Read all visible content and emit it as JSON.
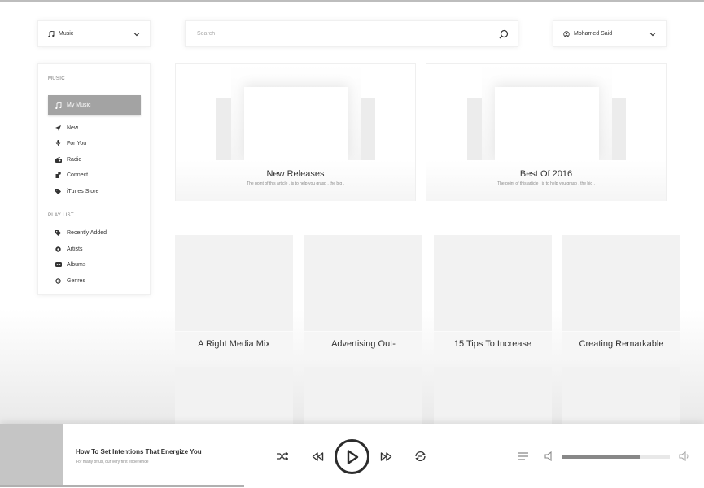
{
  "header": {
    "category_label": "Music",
    "search_placeholder": "Search",
    "user_name": "Mohamed Said"
  },
  "sidebar": {
    "music_title": "MUSIC",
    "active_item": "My Music",
    "music_items": [
      {
        "label": "New",
        "icon": "send-icon"
      },
      {
        "label": "For You",
        "icon": "microphone-icon"
      },
      {
        "label": "Radio",
        "icon": "radio-icon"
      },
      {
        "label": "Connect",
        "icon": "connect-icon"
      },
      {
        "label": "iTunes Store",
        "icon": "tag-icon"
      }
    ],
    "playlist_title": "PLAY LIST",
    "playlist_items": [
      {
        "label": "Recently Added",
        "icon": "tag-icon"
      },
      {
        "label": "Artists",
        "icon": "artist-icon"
      },
      {
        "label": "Albums",
        "icon": "album-icon"
      },
      {
        "label": "Genres",
        "icon": "genre-icon"
      }
    ]
  },
  "features": [
    {
      "title": "New Releases",
      "subtitle": "The point of this article , is to help you grasp , the big ."
    },
    {
      "title": "Best Of 2016",
      "subtitle": "The point of this article , is to help you grasp , the big ."
    }
  ],
  "tiles": [
    {
      "title": "A Right Media Mix"
    },
    {
      "title": "Advertising Out-"
    },
    {
      "title": "15 Tips To Increase"
    },
    {
      "title": "Creating Remarkable"
    }
  ],
  "player": {
    "title": "How To Set Intentions That Energize You",
    "subtitle": "For many of us, our very first experience",
    "volume_level": 0.72
  }
}
